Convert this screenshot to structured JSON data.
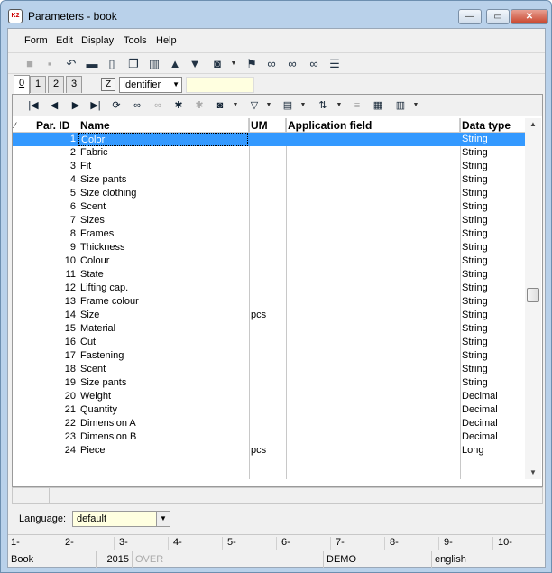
{
  "window": {
    "title": "Parameters - book",
    "app_icon_text": "K2",
    "min_glyph": "—",
    "max_glyph": "▭",
    "close_glyph": "✕"
  },
  "menu": [
    "Form",
    "Edit",
    "Display",
    "Tools",
    "Help"
  ],
  "toolbar_icons": [
    "save-icon",
    "save-as-icon",
    "undo-icon",
    "open-folder-icon",
    "new-document-icon",
    "copy-icon",
    "book-icon",
    "up-arrow-icon",
    "down-arrow-icon",
    "camera-icon",
    "dropdown-icon",
    "filter-icon",
    "binoculars-icon",
    "binoculars-next-icon",
    "binoculars-filter-icon",
    "menu-lines-icon"
  ],
  "tabs": [
    "0",
    "1",
    "2",
    "3"
  ],
  "tab_z": "Z",
  "identifier": {
    "value": "Identifier",
    "arrow": "▼"
  },
  "nav": {
    "first": "|◀",
    "prev": "◀",
    "next": "▶",
    "last": "▶|"
  },
  "columns": {
    "sort": "⁄",
    "id": "Par. ID",
    "name": "Name",
    "um": "UM",
    "app": "Application field",
    "type": "Data type"
  },
  "rows": [
    {
      "id": "1",
      "name": "Color",
      "um": "",
      "app": "",
      "type": "String"
    },
    {
      "id": "2",
      "name": "Fabric",
      "um": "",
      "app": "",
      "type": "String"
    },
    {
      "id": "3",
      "name": "Fit",
      "um": "",
      "app": "",
      "type": "String"
    },
    {
      "id": "4",
      "name": "Size pants",
      "um": "",
      "app": "",
      "type": "String"
    },
    {
      "id": "5",
      "name": "Size clothing",
      "um": "",
      "app": "",
      "type": "String"
    },
    {
      "id": "6",
      "name": "Scent",
      "um": "",
      "app": "",
      "type": "String"
    },
    {
      "id": "7",
      "name": "Sizes",
      "um": "",
      "app": "",
      "type": "String"
    },
    {
      "id": "8",
      "name": "Frames",
      "um": "",
      "app": "",
      "type": "String"
    },
    {
      "id": "9",
      "name": "Thickness",
      "um": "",
      "app": "",
      "type": "String"
    },
    {
      "id": "10",
      "name": "Colour",
      "um": "",
      "app": "",
      "type": "String"
    },
    {
      "id": "11",
      "name": "State",
      "um": "",
      "app": "",
      "type": "String"
    },
    {
      "id": "12",
      "name": "Lifting cap.",
      "um": "",
      "app": "",
      "type": "String"
    },
    {
      "id": "13",
      "name": "Frame colour",
      "um": "",
      "app": "",
      "type": "String"
    },
    {
      "id": "14",
      "name": "Size",
      "um": "pcs",
      "app": "",
      "type": "String"
    },
    {
      "id": "15",
      "name": "Material",
      "um": "",
      "app": "",
      "type": "String"
    },
    {
      "id": "16",
      "name": "Cut",
      "um": "",
      "app": "",
      "type": "String"
    },
    {
      "id": "17",
      "name": "Fastening",
      "um": "",
      "app": "",
      "type": "String"
    },
    {
      "id": "18",
      "name": "Scent",
      "um": "",
      "app": "",
      "type": "String"
    },
    {
      "id": "19",
      "name": "Size pants",
      "um": "",
      "app": "",
      "type": "String"
    },
    {
      "id": "20",
      "name": "Weight",
      "um": "",
      "app": "",
      "type": "Decimal"
    },
    {
      "id": "21",
      "name": "Quantity",
      "um": "",
      "app": "",
      "type": "Decimal"
    },
    {
      "id": "22",
      "name": "Dimension A",
      "um": "",
      "app": "",
      "type": "Decimal"
    },
    {
      "id": "23",
      "name": "Dimension B",
      "um": "",
      "app": "",
      "type": "Decimal"
    },
    {
      "id": "24",
      "name": "Piece",
      "um": "pcs",
      "app": "",
      "type": "Long"
    }
  ],
  "selected_row_index": 0,
  "language": {
    "label": "Language:",
    "value": "default",
    "arrow": "▼"
  },
  "fkeys": [
    "1-",
    "2-",
    "3-",
    "4-",
    "5-",
    "6-",
    "7-",
    "8-",
    "9-",
    "10-"
  ],
  "status": {
    "book": "Book",
    "year": "2015",
    "mode": "OVER",
    "db": "DEMO",
    "lang": "english"
  }
}
